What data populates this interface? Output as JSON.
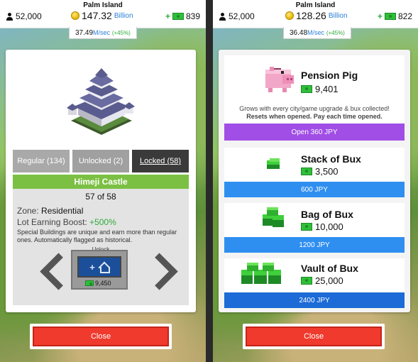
{
  "colors": {
    "accent_green": "#7cc043",
    "close_red": "#f03a2d",
    "purple": "#a14ee6",
    "blue": "#2f8ff0"
  },
  "left": {
    "header": {
      "island": "Palm Island",
      "population": "52,000",
      "coins": "147.32",
      "coins_unit": "Billion",
      "bux": "839"
    },
    "rate": {
      "value": "37.49",
      "unit": "M/sec",
      "boost": "(+45%)"
    },
    "tabs": [
      {
        "label": "Regular (134)"
      },
      {
        "label": "Unlocked (2)"
      },
      {
        "label": "Locked (58)"
      }
    ],
    "building": {
      "name": "Himeji Castle",
      "count": "57 of 58",
      "zone_label": "Zone:",
      "zone_value": "Residential",
      "boost_label": "Lot Earning Boost:",
      "boost_value": "+500%",
      "description": "Special Buildings are unique and earn more than regular ones. Automatically flagged as historical."
    },
    "unlock": {
      "label": "Unlock",
      "cost": "9,450"
    },
    "close_label": "Close"
  },
  "right": {
    "header": {
      "island": "Palm Island",
      "population": "52,000",
      "coins": "128.26",
      "coins_unit": "Billion",
      "bux": "822"
    },
    "rate": {
      "value": "36.48",
      "unit": "M/sec",
      "boost": "(+45%)"
    },
    "offers": [
      {
        "title": "Pension Pig",
        "amount": "9,401",
        "button": "Open 360 JPY",
        "note1": "Grows with every city/game upgrade & bux collected!",
        "note2": "Resets when opened. Pay each time opened."
      },
      {
        "title": "Stack of Bux",
        "amount": "3,500",
        "button": "600 JPY"
      },
      {
        "title": "Bag of Bux",
        "amount": "10,000",
        "button": "1200 JPY"
      },
      {
        "title": "Vault of Bux",
        "amount": "25,000",
        "button": "2400 JPY"
      }
    ],
    "close_label": "Close"
  }
}
